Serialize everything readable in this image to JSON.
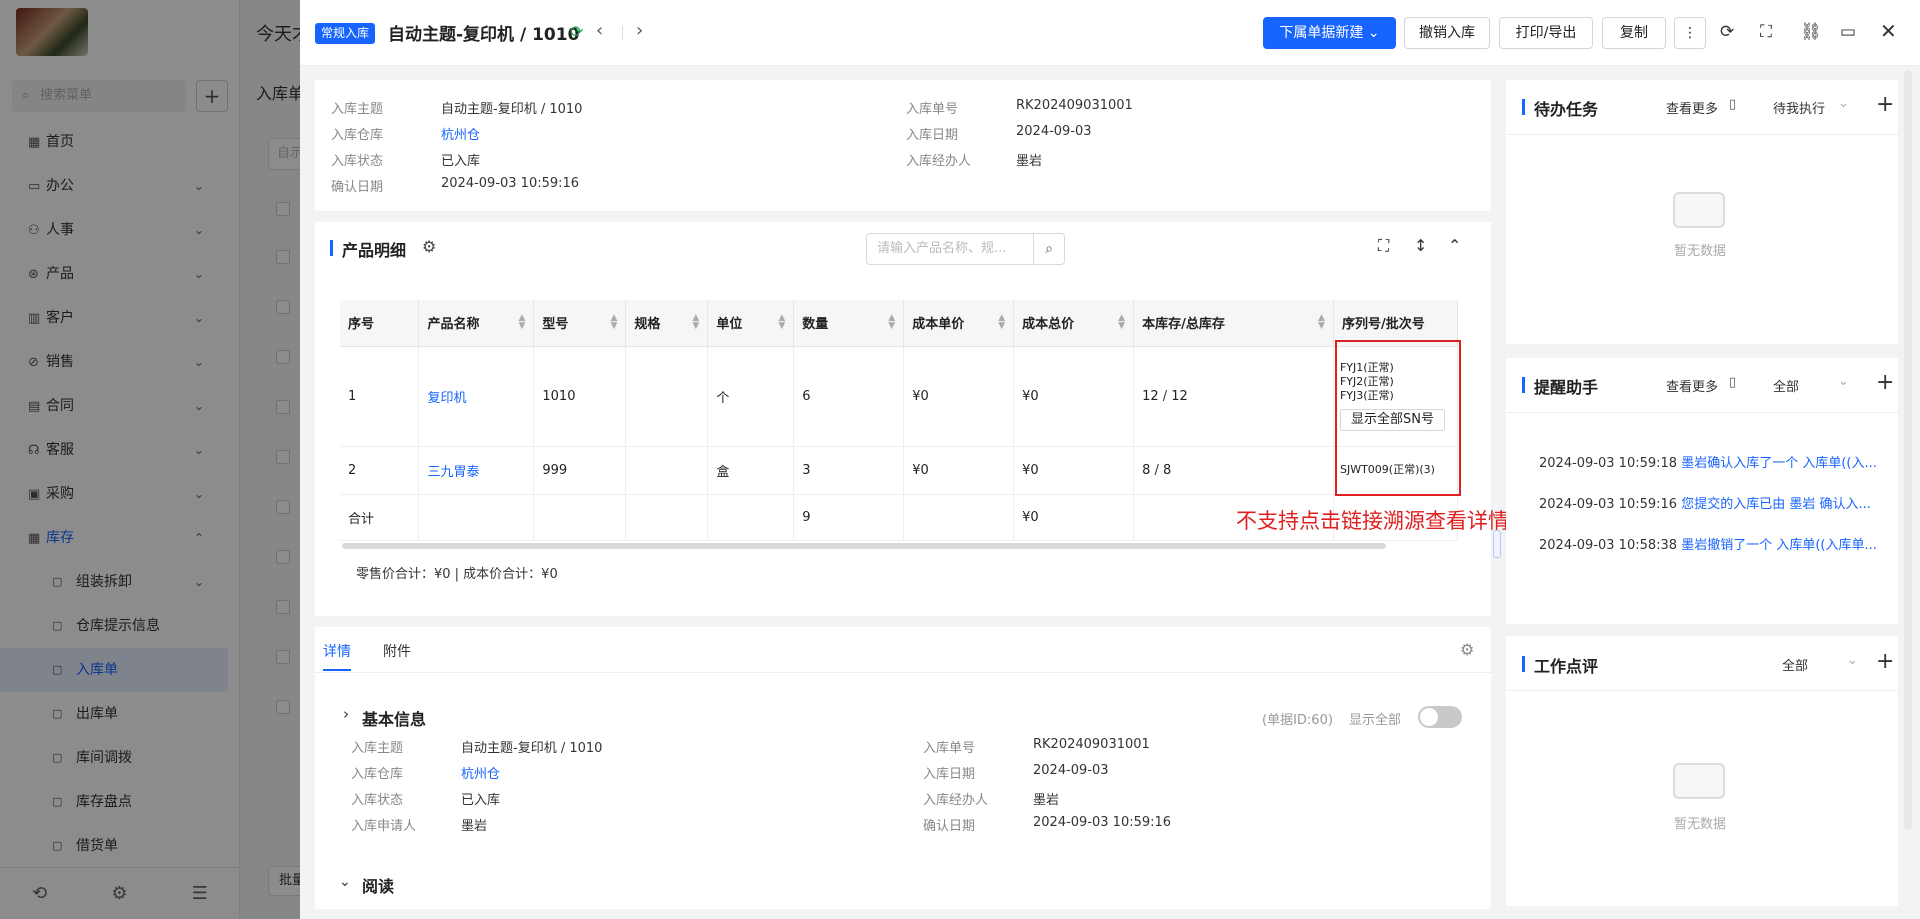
{
  "background": {
    "search_placeholder": "搜索菜单",
    "today": "今天才",
    "tab": "入库单",
    "input_placeholder": "自示",
    "batch": "批量",
    "menu": [
      {
        "label": "首页",
        "icon": "▦",
        "chev": ""
      },
      {
        "label": "办公",
        "icon": "▭",
        "chev": "⌄"
      },
      {
        "label": "人事",
        "icon": "⚇",
        "chev": "⌄"
      },
      {
        "label": "产品",
        "icon": "⊛",
        "chev": "⌄"
      },
      {
        "label": "客户",
        "icon": "▥",
        "chev": "⌄"
      },
      {
        "label": "销售",
        "icon": "⊘",
        "chev": "⌄"
      },
      {
        "label": "合同",
        "icon": "▤",
        "chev": "⌄"
      },
      {
        "label": "客服",
        "icon": "☊",
        "chev": "⌄"
      },
      {
        "label": "采购",
        "icon": "▣",
        "chev": "⌄"
      },
      {
        "label": "库存",
        "icon": "▦",
        "chev": "⌃"
      }
    ],
    "submenu": [
      {
        "label": "组装拆卸",
        "chev": "⌄"
      },
      {
        "label": "仓库提示信息",
        "chev": ""
      },
      {
        "label": "入库单",
        "chev": ""
      },
      {
        "label": "出库单",
        "chev": ""
      },
      {
        "label": "库间调拨",
        "chev": ""
      },
      {
        "label": "库存盘点",
        "chev": ""
      },
      {
        "label": "借货单",
        "chev": ""
      }
    ]
  },
  "header": {
    "type_tag": "常规入库",
    "title": "自动主题-复印机 / 1010",
    "buttons": {
      "new_sub": "下属单据新建",
      "undo": "撤销入库",
      "print": "打印/导出",
      "copy": "复制"
    }
  },
  "summary": {
    "left": [
      {
        "label": "入库主题",
        "value": "自动主题-复印机 / 1010",
        "link": false
      },
      {
        "label": "入库仓库",
        "value": "杭州仓",
        "link": true
      },
      {
        "label": "入库状态",
        "value": "已入库",
        "link": false
      },
      {
        "label": "确认日期",
        "value": "2024-09-03 10:59:16",
        "link": false
      }
    ],
    "right": [
      {
        "label": "入库单号",
        "value": "RK202409031001"
      },
      {
        "label": "入库日期",
        "value": "2024-09-03"
      },
      {
        "label": "入库经办人",
        "value": "墨岩"
      }
    ]
  },
  "products": {
    "title": "产品明细",
    "search_placeholder": "请输入产品名称、规...",
    "columns": [
      "序号",
      "产品名称",
      "型号",
      "规格",
      "单位",
      "数量",
      "成本单价",
      "成本总价",
      "本库存/总库存",
      "序列号/批次号"
    ],
    "rows": [
      {
        "no": "1",
        "name": "复印机",
        "model": "1010",
        "spec": "",
        "unit": "个",
        "qty": "6",
        "unit_cost": "¥0",
        "total_cost": "¥0",
        "stock": "12",
        "total_stock": "12",
        "sn": [
          "FYJ1(正常)",
          "FYJ2(正常)",
          "FYJ3(正常)"
        ],
        "sn_button": "显示全部SN号"
      },
      {
        "no": "2",
        "name": "三九胃泰",
        "model": "999",
        "spec": "",
        "unit": "盒",
        "qty": "3",
        "unit_cost": "¥0",
        "total_cost": "¥0",
        "stock": "8",
        "total_stock": "8",
        "sn": [
          "SJWT009(正常)(3)"
        ],
        "sn_button": ""
      }
    ],
    "total": {
      "label": "合计",
      "qty": "9",
      "total_cost": "¥0"
    },
    "footer": "零售价合计：¥0 |   成本价合计：¥0",
    "annotation": "不支持点击链接溯源查看详情"
  },
  "detail": {
    "tabs": [
      "详情",
      "附件"
    ],
    "basic_title": "基本信息",
    "doc_id": "(单据ID:60)",
    "show_all": "显示全部",
    "left": [
      {
        "label": "入库主题",
        "value": "自动主题-复印机 / 1010",
        "link": false
      },
      {
        "label": "入库仓库",
        "value": "杭州仓",
        "link": true
      },
      {
        "label": "入库状态",
        "value": "已入库",
        "link": false
      },
      {
        "label": "入库申请人",
        "value": "墨岩",
        "link": false
      }
    ],
    "right": [
      {
        "label": "入库单号",
        "value": "RK202409031001"
      },
      {
        "label": "入库日期",
        "value": "2024-09-03"
      },
      {
        "label": "入库经办人",
        "value": "墨岩"
      },
      {
        "label": "确认日期",
        "value": "2024-09-03 10:59:16"
      }
    ],
    "read_title": "阅读"
  },
  "todo": {
    "title": "待办任务",
    "more": "查看更多",
    "filter": "待我执行",
    "empty": "暂无数据"
  },
  "reminder": {
    "title": "提醒助手",
    "more": "查看更多",
    "filter": "全部",
    "items": [
      {
        "time": "2024-09-03 10:59:18",
        "text": "墨岩确认入库了一个 入库单((入..."
      },
      {
        "time": "2024-09-03 10:59:16",
        "text": "您提交的入库已由 墨岩 确认入..."
      },
      {
        "time": "2024-09-03 10:58:38",
        "text": "墨岩撤销了一个 入库单((入库单..."
      }
    ]
  },
  "review": {
    "title": "工作点评",
    "filter": "全部",
    "empty": "暂无数据"
  }
}
